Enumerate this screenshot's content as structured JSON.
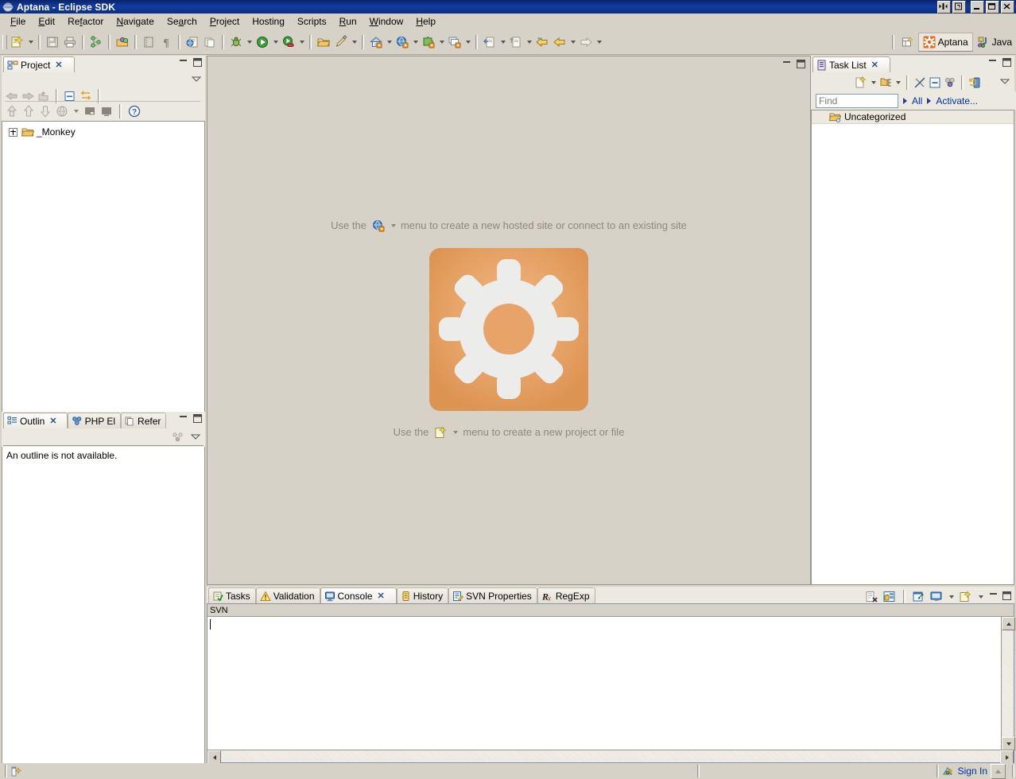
{
  "window": {
    "title": "Aptana - Eclipse SDK",
    "icon": "eclipse-globe-icon",
    "buttons": [
      {
        "name": "restore-down-split-button",
        "glyph": "split"
      },
      {
        "name": "restore-window-button",
        "glyph": "restore-small"
      },
      {
        "name": "minimize-button",
        "glyph": "minimize"
      },
      {
        "name": "maximize-button",
        "glyph": "maximize"
      },
      {
        "name": "close-button",
        "glyph": "close"
      }
    ]
  },
  "menubar": {
    "items": [
      {
        "name": "menu-file",
        "label": "File",
        "mnemonic": "F"
      },
      {
        "name": "menu-edit",
        "label": "Edit",
        "mnemonic": "E"
      },
      {
        "name": "menu-refactor",
        "label": "Refactor",
        "mnemonic": "t"
      },
      {
        "name": "menu-navigate",
        "label": "Navigate",
        "mnemonic": "N"
      },
      {
        "name": "menu-search",
        "label": "Search",
        "mnemonic": "a"
      },
      {
        "name": "menu-project",
        "label": "Project",
        "mnemonic": "P"
      },
      {
        "name": "menu-hosting",
        "label": "Hosting",
        "mnemonic": ""
      },
      {
        "name": "menu-scripts",
        "label": "Scripts",
        "mnemonic": ""
      },
      {
        "name": "menu-run",
        "label": "Run",
        "mnemonic": "R"
      },
      {
        "name": "menu-window",
        "label": "Window",
        "mnemonic": "W"
      },
      {
        "name": "menu-help",
        "label": "Help",
        "mnemonic": "H"
      }
    ]
  },
  "toolbar": {
    "buttons": [
      {
        "name": "new-wizard-button",
        "icon": "new-file-icon",
        "dropdown": true
      },
      {
        "name": "save-button",
        "icon": "save-disk-icon",
        "dropdown": false
      },
      {
        "name": "print-button",
        "icon": "printer-icon",
        "dropdown": false
      },
      {
        "name": "build-all-button",
        "icon": "build-nodes-icon",
        "dropdown": false
      },
      {
        "name": "open-package-button",
        "icon": "open-folder-ball-icon",
        "dropdown": false
      },
      {
        "name": "toggle-block-selection-button",
        "icon": "block-selection-icon",
        "dropdown": false
      },
      {
        "name": "show-whitespace-button",
        "icon": "pilcrow-icon",
        "dropdown": false
      },
      {
        "name": "preview-browser-button",
        "icon": "globe-page-icon",
        "dropdown": false
      },
      {
        "name": "copy-page-button",
        "icon": "pages-icon",
        "dropdown": false
      },
      {
        "name": "debug-button",
        "icon": "bug-icon",
        "dropdown": true
      },
      {
        "name": "run-button",
        "icon": "run-green-play-icon",
        "dropdown": true
      },
      {
        "name": "external-tools-button",
        "icon": "run-external-icon",
        "dropdown": true
      },
      {
        "name": "open-folder-button",
        "icon": "folder-open-icon",
        "dropdown": false
      },
      {
        "name": "edit-pencil-button",
        "icon": "pencil-icon",
        "dropdown": true
      },
      {
        "name": "new-project-home-button",
        "icon": "house-icon",
        "dropdown": true
      },
      {
        "name": "new-site-button",
        "icon": "world-globe-icon",
        "dropdown": true
      },
      {
        "name": "new-plugin-button",
        "icon": "puzzle-piece-icon",
        "dropdown": true
      },
      {
        "name": "new-window-button",
        "icon": "windows-stack-icon",
        "dropdown": true
      },
      {
        "name": "open-type-button",
        "icon": "open-type-icon",
        "dropdown": true
      },
      {
        "name": "open-task-button",
        "icon": "open-task-icon",
        "dropdown": true
      },
      {
        "name": "last-edit-location-button",
        "icon": "back-arrow-star-icon",
        "dropdown": false
      },
      {
        "name": "back-button",
        "icon": "back-arrow-icon",
        "dropdown": true
      },
      {
        "name": "forward-button",
        "icon": "forward-arrow-icon",
        "dropdown": true
      }
    ],
    "perspectives": [
      {
        "name": "open-perspective-button",
        "label": "",
        "icon": "open-perspective-icon",
        "active": false
      },
      {
        "name": "perspective-aptana",
        "label": "Aptana",
        "icon": "aptana-gear-icon",
        "active": true
      },
      {
        "name": "perspective-java",
        "label": "Java",
        "icon": "java-icon",
        "active": false
      }
    ]
  },
  "project_view": {
    "tabs": [
      {
        "name": "tab-project",
        "label": "Project",
        "icon": "project-icon",
        "active": true,
        "closable": true
      }
    ],
    "minimize_label": "Minimize",
    "maximize_label": "Maximize",
    "toolbar_row1": [
      {
        "name": "back-button",
        "icon": "left-arrow-icon"
      },
      {
        "name": "forward-button",
        "icon": "right-arrow-icon"
      },
      {
        "name": "up-button",
        "icon": "up-folder-icon"
      },
      {
        "name": "collapse-all-button",
        "icon": "collapse-all-icon"
      },
      {
        "name": "link-with-editor-button",
        "icon": "link-editor-icon"
      }
    ],
    "toolbar_row2": [
      {
        "name": "upload-button",
        "icon": "upload-arrow-icon"
      },
      {
        "name": "put-button",
        "icon": "up-arrow-icon"
      },
      {
        "name": "get-button",
        "icon": "down-arrow-icon"
      },
      {
        "name": "connection-button",
        "icon": "globe-icon",
        "dropdown": true
      },
      {
        "name": "sync-local-button",
        "icon": "local-view-icon"
      },
      {
        "name": "sync-remote-button",
        "icon": "remote-view-icon"
      },
      {
        "name": "help-button",
        "icon": "help-question-icon"
      }
    ],
    "tree": [
      {
        "name": "tree-item-monkey",
        "label": "_Monkey",
        "icon": "folder-icon",
        "expanded": false
      }
    ]
  },
  "outline_view": {
    "tabs": [
      {
        "name": "tab-outline",
        "label": "Outlin",
        "icon": "outline-icon",
        "active": true,
        "closable": true
      },
      {
        "name": "tab-php-explorer",
        "label": "PHP El",
        "icon": "php-explorer-icon",
        "active": false,
        "closable": false
      },
      {
        "name": "tab-references",
        "label": "Refer",
        "icon": "references-icon",
        "active": false,
        "closable": false
      }
    ],
    "toolbar": [
      {
        "name": "sort-button",
        "icon": "sort-icon"
      }
    ],
    "message": "An outline is not available."
  },
  "editor_area": {
    "hint_top": {
      "prefix": "Use the",
      "icon": "new-site-globe-icon",
      "suffix": "menu to create a new hosted site or connect to an existing site"
    },
    "logo": {
      "name": "aptana-gear-logo",
      "color": "#e8a468",
      "gear_color": "#ececea"
    },
    "hint_bottom": {
      "prefix": "Use the",
      "icon": "new-project-file-icon",
      "suffix": "menu to create a new project or file"
    },
    "minimize_label": "Minimize",
    "maximize_label": "Maximize"
  },
  "task_list": {
    "tabs": [
      {
        "name": "tab-task-list",
        "label": "Task List",
        "icon": "task-list-icon",
        "active": true,
        "closable": true
      }
    ],
    "toolbar": [
      {
        "name": "new-task-button",
        "icon": "new-task-icon",
        "dropdown": true
      },
      {
        "name": "categorize-button",
        "icon": "categorize-icon",
        "dropdown": true
      },
      {
        "name": "focus-on-workweek-button",
        "icon": "filter-slash-icon"
      },
      {
        "name": "collapse-all-button",
        "icon": "collapse-all-icon"
      },
      {
        "name": "presentation-button",
        "icon": "presentation-icon"
      },
      {
        "name": "synchronize-button",
        "icon": "synchronize-icon"
      }
    ],
    "search": {
      "name": "find-input",
      "value": "",
      "placeholder": "Find"
    },
    "filters": [
      {
        "name": "filter-all",
        "label": "All"
      },
      {
        "name": "filter-activate",
        "label": "Activate..."
      }
    ],
    "items": [
      {
        "name": "task-category-uncategorized",
        "label": "Uncategorized",
        "icon": "category-folder-icon"
      }
    ]
  },
  "bottom_panel": {
    "tabs": [
      {
        "name": "tab-tasks",
        "label": "Tasks",
        "icon": "tasks-icon",
        "active": false,
        "closable": false
      },
      {
        "name": "tab-validation",
        "label": "Validation",
        "icon": "warning-icon",
        "active": false,
        "closable": false
      },
      {
        "name": "tab-console",
        "label": "Console",
        "icon": "console-icon",
        "active": true,
        "closable": true
      },
      {
        "name": "tab-history",
        "label": "History",
        "icon": "history-icon",
        "active": false,
        "closable": false
      },
      {
        "name": "tab-svn-properties",
        "label": "SVN Properties",
        "icon": "svn-properties-icon",
        "active": false,
        "closable": false
      },
      {
        "name": "tab-regexp",
        "label": "RegExp",
        "icon": "regexp-icon",
        "active": false,
        "closable": false
      }
    ],
    "toolbar": [
      {
        "name": "clear-console-button",
        "icon": "clear-console-icon"
      },
      {
        "name": "scroll-lock-button",
        "icon": "scroll-lock-icon"
      },
      {
        "name": "pin-console-button",
        "icon": "pin-console-icon"
      },
      {
        "name": "display-selected-console-button",
        "icon": "display-console-icon",
        "dropdown": true
      },
      {
        "name": "open-console-button",
        "icon": "open-console-icon",
        "dropdown": true
      }
    ],
    "console": {
      "label": "SVN",
      "content": ""
    },
    "minimize_label": "Minimize",
    "maximize_label": "Maximize"
  },
  "statusbar": {
    "left_icon": "writable-indicator-icon",
    "signin": {
      "name": "sign-in-link",
      "label": "Sign In",
      "icon": "aptana-signin-icon"
    },
    "resize_grip": "resize-grip"
  },
  "colors": {
    "title_bar": "#0a246a",
    "chrome": "#d6d2c7",
    "accent_orange": "#e8a468",
    "link_blue": "#00319c",
    "hint_text": "#8d8878"
  }
}
